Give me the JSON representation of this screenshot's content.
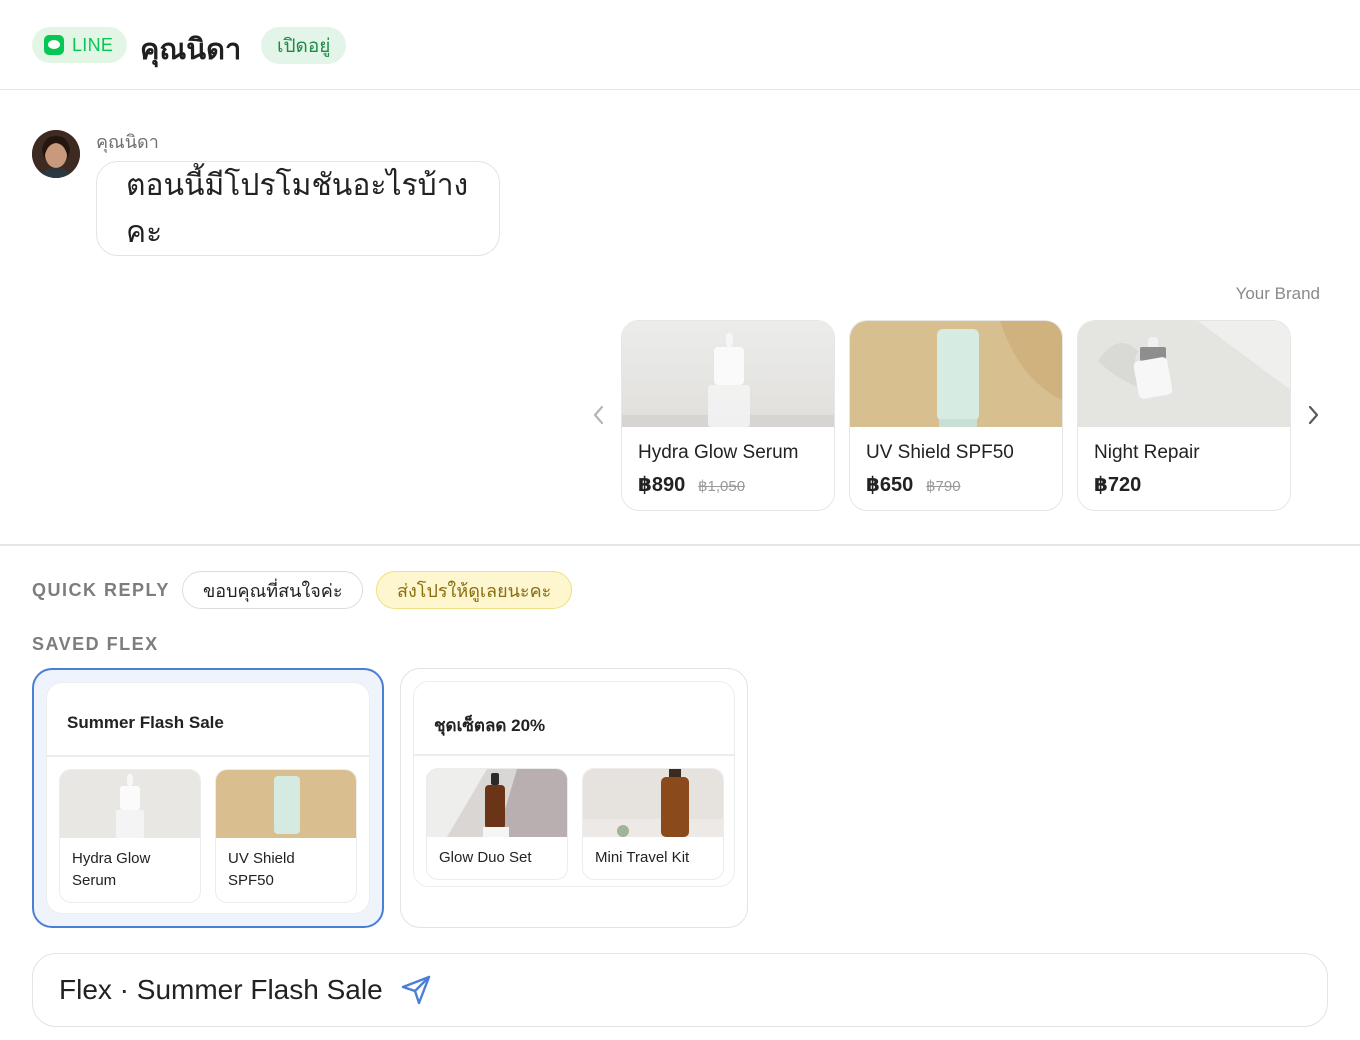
{
  "header": {
    "channel_label": "LINE",
    "contact_name": "คุณนิดา",
    "status": "เปิดอยู่"
  },
  "message": {
    "sender": "คุณนิดา",
    "text": "ตอนนี้มีโปรโมชันอะไรบ้างคะ"
  },
  "carousel": {
    "brand": "Your Brand",
    "cards": [
      {
        "title": "Hydra Glow Serum",
        "price": "฿890",
        "old_price": "฿1,050"
      },
      {
        "title": "UV Shield SPF50",
        "price": "฿650",
        "old_price": "฿790"
      },
      {
        "title": "Night Repair",
        "price": "฿720",
        "old_price": ""
      }
    ]
  },
  "quick_reply": {
    "label": "QUICK REPLY",
    "chips": [
      "ขอบคุณที่สนใจค่ะ",
      "ส่งโปรให้ดูเลยนะคะ"
    ]
  },
  "saved_flex": {
    "label": "SAVED FLEX",
    "items": [
      {
        "title": "Summer Flash Sale",
        "products": [
          "Hydra Glow Serum",
          "UV Shield SPF50"
        ]
      },
      {
        "title": "ชุดเซ็ตลด 20%",
        "products": [
          "Glow Duo Set",
          "Mini Travel Kit"
        ]
      }
    ]
  },
  "composer": {
    "text": "Flex · Summer Flash Sale"
  },
  "colors": {
    "line_green": "#06c755",
    "selected_border": "#4a7fd4",
    "send_icon": "#4a7fd4"
  }
}
